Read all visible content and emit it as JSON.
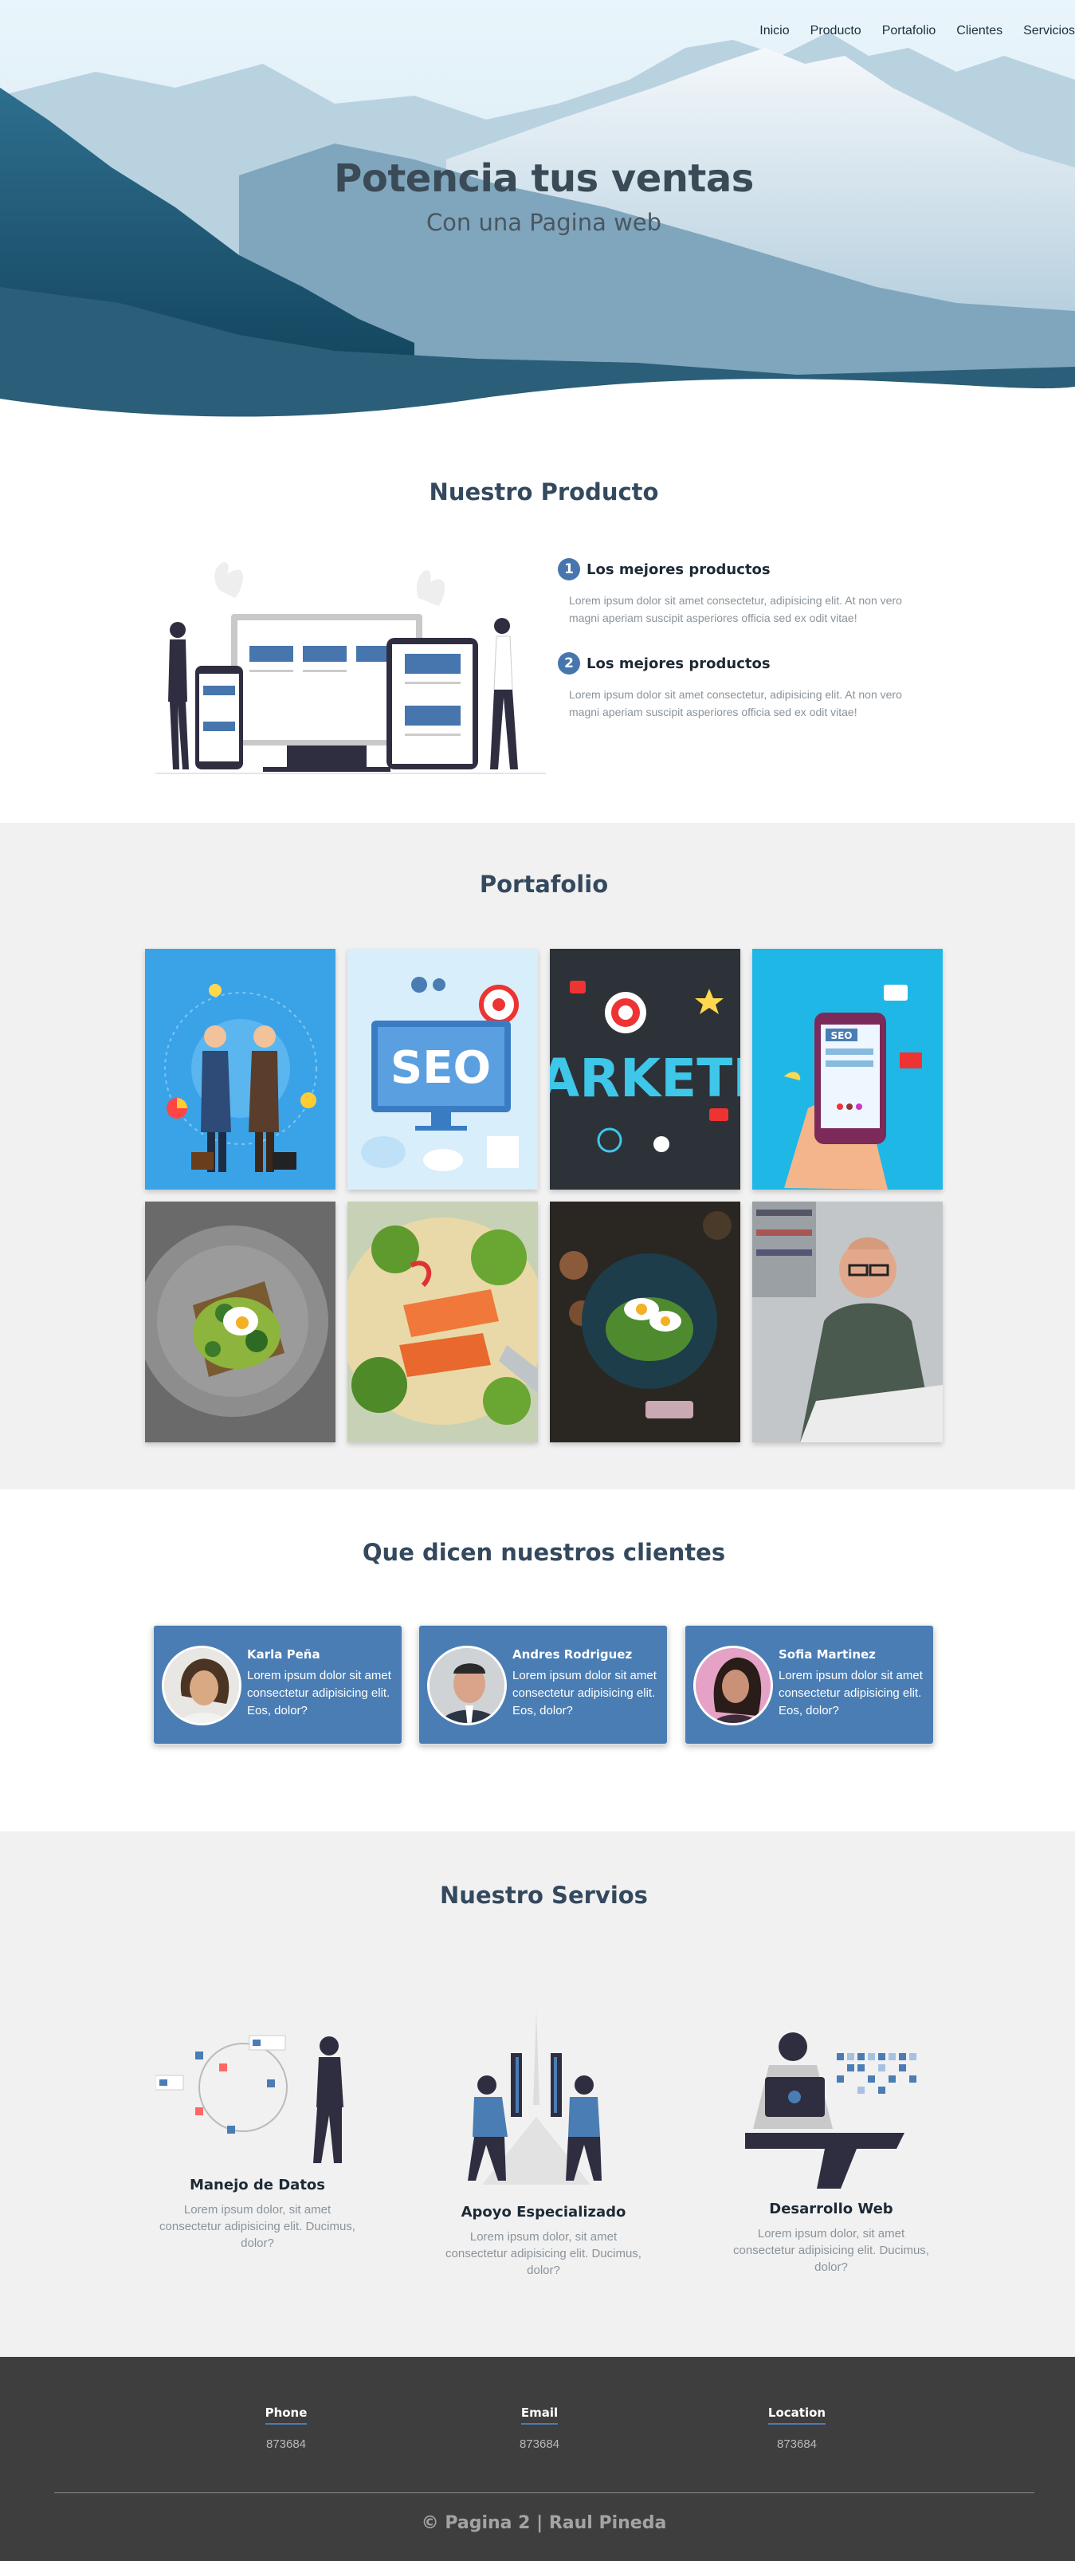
{
  "nav": [
    "Inicio",
    "Producto",
    "Portafolio",
    "Clientes",
    "Servicios"
  ],
  "hero": {
    "title": "Potencia tus ventas",
    "subtitle": "Con una Pagina web"
  },
  "product": {
    "title": "Nuestro Producto",
    "features": [
      {
        "num": "1",
        "title": "Los mejores productos",
        "text": "Lorem ipsum dolor sit amet consectetur, adipisicing elit. At non vero magni aperiam suscipit asperiores officia sed ex odit vitae!"
      },
      {
        "num": "2",
        "title": "Los mejores productos",
        "text": "Lorem ipsum dolor sit amet consectetur, adipisicing elit. At non vero magni aperiam suscipit asperiores officia sed ex odit vitae!"
      }
    ]
  },
  "portfolio": {
    "title": "Portafolio",
    "seo_word": "SEO",
    "marketing_word": "ARKETI",
    "phone_seo": "SEO"
  },
  "clients": {
    "title": "Que dicen nuestros clientes",
    "items": [
      {
        "name": "Karla Peña",
        "text": "Lorem ipsum dolor sit amet consectetur adipisicing elit. Eos, dolor?"
      },
      {
        "name": "Andres Rodriguez",
        "text": "Lorem ipsum dolor sit amet consectetur adipisicing elit. Eos, dolor?"
      },
      {
        "name": "Sofia Martinez",
        "text": "Lorem ipsum dolor sit amet consectetur adipisicing elit. Eos, dolor?"
      }
    ]
  },
  "services": {
    "title": "Nuestro Servios",
    "items": [
      {
        "title": "Manejo de Datos",
        "text": "Lorem ipsum dolor, sit amet consectetur adipisicing elit. Ducimus, dolor?"
      },
      {
        "title": "Apoyo Especializado",
        "text": "Lorem ipsum dolor, sit amet consectetur adipisicing elit. Ducimus, dolor?"
      },
      {
        "title": "Desarrollo Web",
        "text": "Lorem ipsum dolor, sit amet consectetur adipisicing elit. Ducimus, dolor?"
      }
    ]
  },
  "footer": {
    "columns": [
      {
        "label": "Phone",
        "value": "873684"
      },
      {
        "label": "Email",
        "value": "873684"
      },
      {
        "label": "Location",
        "value": "873684"
      }
    ],
    "copyright": "© Pagina 2 | Raul Pineda"
  },
  "colors": {
    "accent": "#4a7db4",
    "footer_bg": "#3e3e3e",
    "band_bg": "#f1f1f1"
  }
}
